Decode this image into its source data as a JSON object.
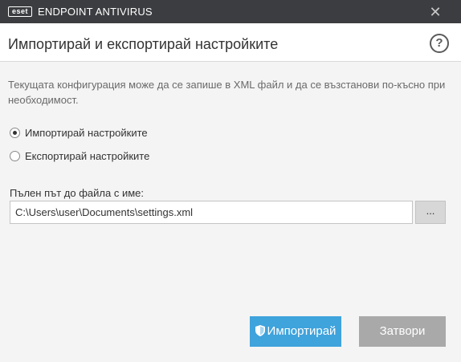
{
  "app": {
    "logo_text": "eset",
    "product_name": "ENDPOINT ANTIVIRUS",
    "close_glyph": "✕"
  },
  "page": {
    "title": "Импортирай и експортирай настройките",
    "help_glyph": "?",
    "description": "Текущата конфигурация може да се запише в XML файл и да се възстанови по-късно при необходимост."
  },
  "options": [
    {
      "label": "Импортирай настройките",
      "selected": true
    },
    {
      "label": "Експортирай настройките",
      "selected": false
    }
  ],
  "file": {
    "label": "Пълен път до файла с име:",
    "value": "C:\\Users\\user\\Documents\\settings.xml",
    "browse_label": "..."
  },
  "buttons": {
    "import_label": "Импортирай",
    "import_icon": "shield-icon",
    "close_label": "Затвори"
  },
  "colors": {
    "titlebar": "#3c3d40",
    "primary_button": "#3fa3dc",
    "secondary_button": "#a9a9a9"
  }
}
